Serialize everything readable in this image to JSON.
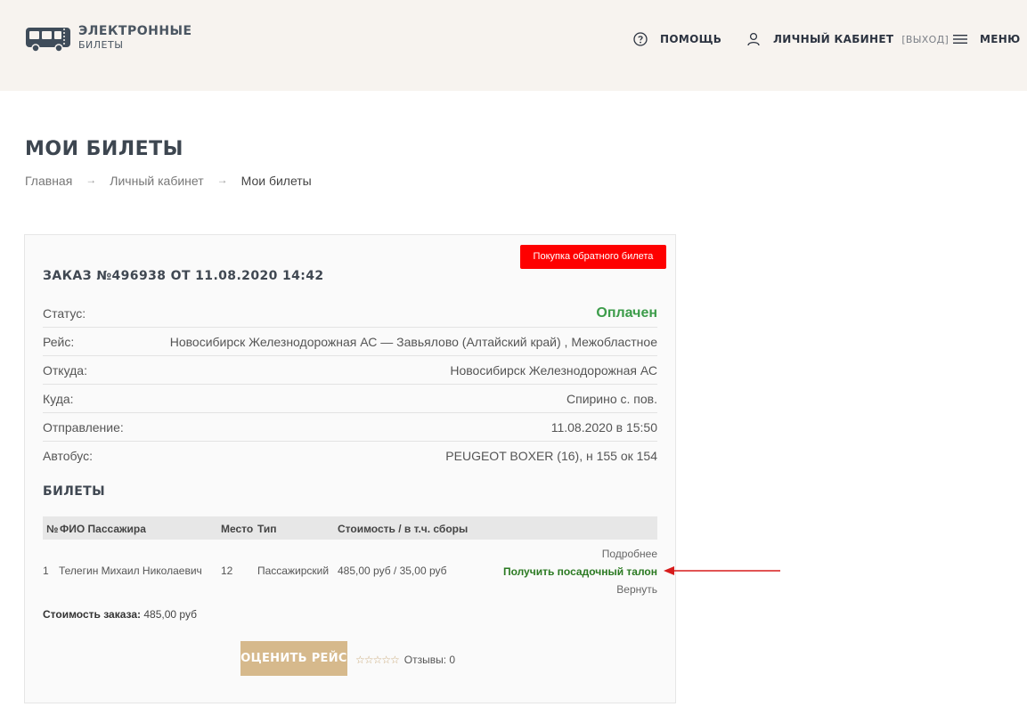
{
  "header": {
    "logo_title": "ЭЛЕКТРОННЫЕ",
    "logo_subtitle": "БИЛЕТЫ",
    "help": "ПОМОЩЬ",
    "cabinet": "ЛИЧНЫЙ КАБИНЕТ",
    "exit": "[ВЫХОД]",
    "menu": "МЕНЮ"
  },
  "page": {
    "title": "МОИ БИЛЕТЫ",
    "breadcrumb": [
      "Главная",
      "Личный кабинет",
      "Мои билеты"
    ],
    "breadcrumb_sep": "→"
  },
  "order": {
    "return_button": "Покупка обратного билета",
    "title": "ЗАКАЗ №496938 ОТ 11.08.2020 14:42",
    "fields": [
      {
        "label": "Статус:",
        "value": "Оплачен"
      },
      {
        "label": "Рейс:",
        "value": "Новосибирск Железнодорожная АС — Завьялово (Алтайский край) , Межобластное"
      },
      {
        "label": "Откуда:",
        "value": "Новосибирск Железнодорожная АС"
      },
      {
        "label": "Куда:",
        "value": "Спирино с. пов."
      },
      {
        "label": "Отправление:",
        "value": "11.08.2020 в 15:50"
      },
      {
        "label": "Автобус:",
        "value": "PEUGEOT BOXER (16), н 155 ок 154"
      }
    ],
    "status_color": "#3c9c4a"
  },
  "tickets": {
    "title": "БИЛЕТЫ",
    "columns": [
      "№",
      "ФИО Пассажира",
      "Место",
      "Тип",
      "Стоимость / в т.ч. сборы"
    ],
    "rows": [
      {
        "num": "1",
        "name": "Телегин Михаил Николаевич",
        "seat": "12",
        "type": "Пассажирский",
        "cost": "485,00 руб / 35,00 руб",
        "more": "Подробнее",
        "boarding": "Получить посадочный талон",
        "refund": "Вернуть"
      }
    ]
  },
  "summary": {
    "cost_label": "Стоимость заказа:",
    "cost_value": "485,00 руб",
    "rate_button": "ОЦЕНИТЬ РЕЙС",
    "stars": "☆☆☆☆☆",
    "reviews": "Отзывы: 0"
  },
  "colors": {
    "accent_red": "#fe0000",
    "rate_button": "#d6b98c",
    "header_bg": "#f7f3ef",
    "boarding_link": "#2b7a22",
    "arrow": "#d71c1c"
  },
  "icons": {
    "logo": "bus-ticket-icon",
    "help": "question-circle-icon",
    "cabinet": "user-icon",
    "menu": "hamburger-icon"
  }
}
